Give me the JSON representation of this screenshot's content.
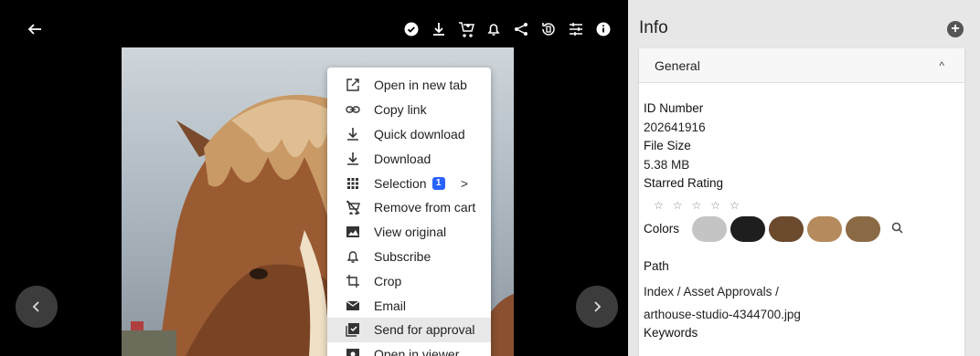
{
  "viewer": {
    "toolbar_icons": [
      "check-circle-icon",
      "download-icon",
      "add-to-cart-icon",
      "bell-icon",
      "share-icon",
      "rotate-icon",
      "sliders-icon",
      "info-icon"
    ]
  },
  "menu": {
    "items": [
      {
        "label": "Open in new tab",
        "icon": "open-in-new-icon"
      },
      {
        "label": "Copy link",
        "icon": "link-icon"
      },
      {
        "label": "Quick download",
        "icon": "download-icon"
      },
      {
        "label": "Download",
        "icon": "download-icon"
      },
      {
        "label": "Selection",
        "icon": "grid-icon",
        "badge": "1"
      },
      {
        "label": "Remove from cart",
        "icon": "remove-cart-icon"
      },
      {
        "label": "View original",
        "icon": "image-icon"
      },
      {
        "label": "Subscribe",
        "icon": "bell-icon"
      },
      {
        "label": "Crop",
        "icon": "crop-icon"
      },
      {
        "label": "Email",
        "icon": "mail-icon"
      },
      {
        "label": "Send for approval",
        "icon": "approval-icon"
      },
      {
        "label": "Open in viewer",
        "icon": "viewer-icon"
      }
    ],
    "selection_arrow": ">"
  },
  "info": {
    "title": "Info",
    "add": "+",
    "section": "General",
    "caret": "^",
    "id_label": "ID Number",
    "id_value": "202641916",
    "size_label": "File Size",
    "size_value": "5.38 MB",
    "rating_label": "Starred Rating",
    "rating_value": 0,
    "stars": [
      "☆",
      "☆",
      "☆",
      "☆",
      "☆"
    ],
    "colors_label": "Colors",
    "colors": [
      "#c4c4c4",
      "#1e1e1e",
      "#6b4a2e",
      "#b58a5c",
      "#8a6a45"
    ],
    "path_label": "Path",
    "path_line1": "Index / Asset Approvals /",
    "path_line2": "arthouse-studio-4344700.jpg",
    "keywords_label": "Keywords"
  }
}
